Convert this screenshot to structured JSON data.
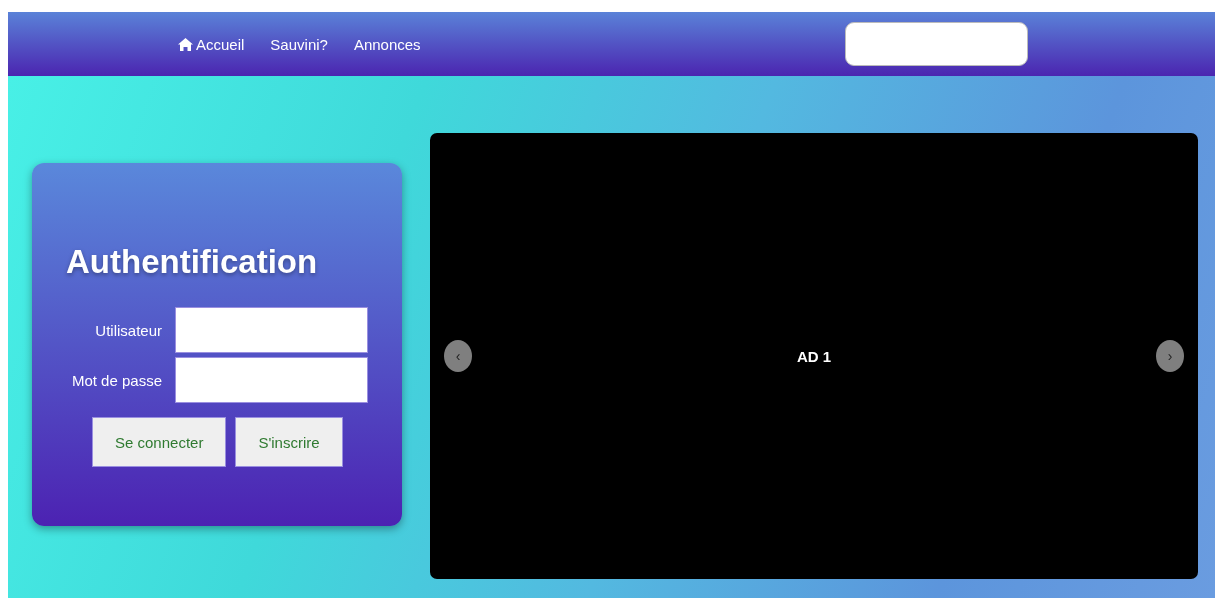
{
  "nav": {
    "items": [
      {
        "label": "Accueil",
        "kind": "home"
      },
      {
        "label": "Sauvini?",
        "kind": "plain"
      },
      {
        "label": "Annonces",
        "kind": "plain"
      }
    ]
  },
  "login": {
    "title": "Authentification",
    "fields": [
      {
        "label": "Utilisateur"
      },
      {
        "label": "Mot de passe"
      }
    ],
    "buttons": [
      "Se connecter",
      "S'inscrire"
    ]
  },
  "carousel": {
    "slide": "AD 1",
    "prev": "‹",
    "next": "›"
  }
}
